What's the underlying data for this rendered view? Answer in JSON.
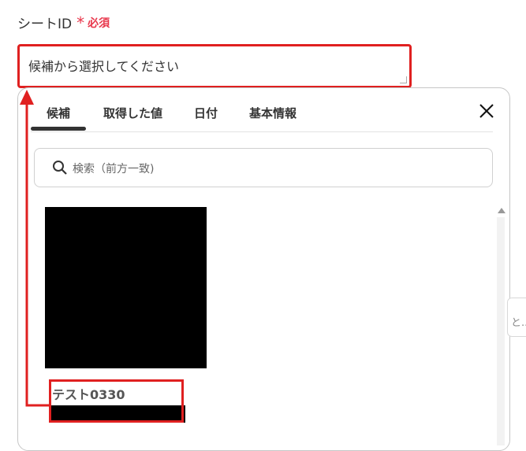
{
  "field": {
    "label": "シートID",
    "required_star": "*",
    "required_text": "必須"
  },
  "select": {
    "placeholder": "候補から選択してください"
  },
  "dropdown": {
    "tabs": [
      {
        "label": "候補",
        "active": true
      },
      {
        "label": "取得した値",
        "active": false
      },
      {
        "label": "日付",
        "active": false
      },
      {
        "label": "基本情報",
        "active": false
      }
    ],
    "search_placeholder": "検索（前方一致)",
    "items": [
      {
        "label": "テスト0330"
      }
    ]
  },
  "side_peek": {
    "text": "と..."
  },
  "colors": {
    "required": "#e8374c",
    "annotation": "#e02020"
  },
  "icons": {
    "close": "close-icon",
    "search": "search-icon"
  }
}
